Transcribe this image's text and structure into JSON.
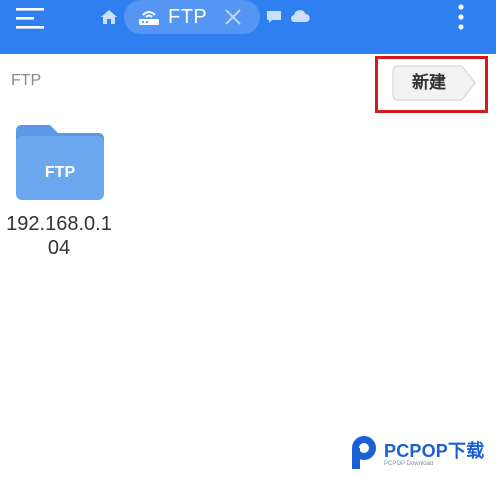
{
  "app": {
    "colors": {
      "toolbar": "#2f7ff0",
      "folder": "#6aa7ee",
      "highlight": "#d6181f",
      "watermark": "#1c5fd6"
    }
  },
  "toolbar": {
    "menu_icon": "menu-icon",
    "home_icon": "home-icon",
    "active_tab": {
      "icon": "router-icon",
      "label": "FTP",
      "close_icon": "close-icon"
    },
    "other_tabs": [
      "chat-icon",
      "cloud-icon"
    ],
    "more_icon": "more-vertical-icon"
  },
  "breadcrumb": {
    "path": "FTP"
  },
  "actions": {
    "new_label": "新建"
  },
  "files": [
    {
      "type": "folder",
      "icon_label": "FTP",
      "name": "192.168.0.104"
    }
  ],
  "watermark": {
    "brand": "PCPOP下载",
    "sub": "PCPOP Download"
  }
}
